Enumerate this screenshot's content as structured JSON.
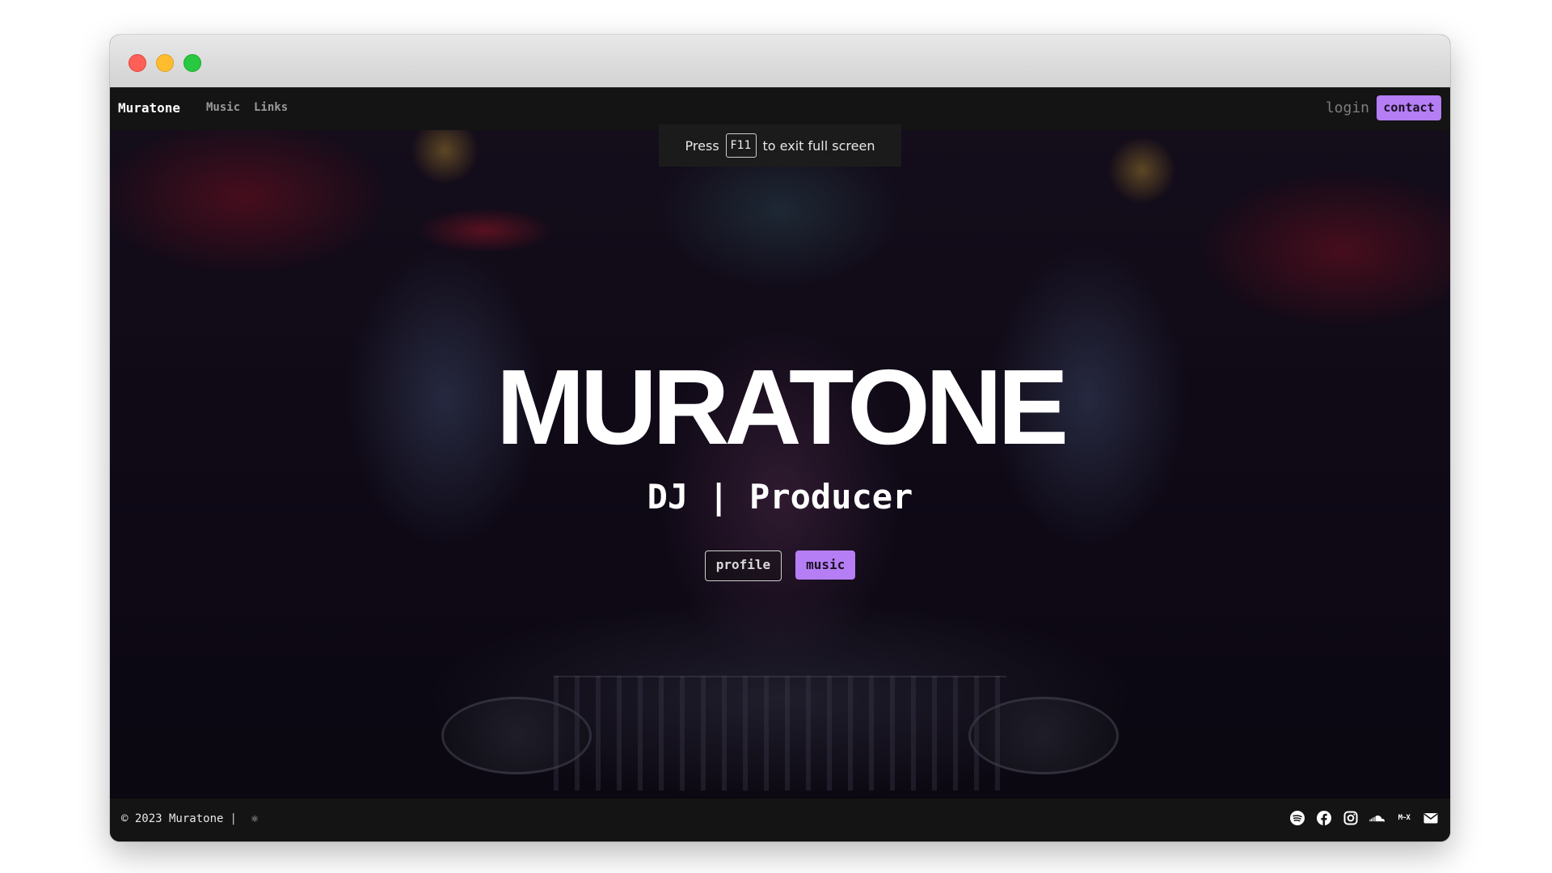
{
  "navbar": {
    "brand": "Muratone",
    "links": [
      "Music",
      "Links"
    ],
    "login": "login",
    "contact": "contact"
  },
  "toast": {
    "before": "Press",
    "key": "F11",
    "after": "to exit full screen"
  },
  "hero": {
    "title": "MURATONE",
    "subtitle": "DJ | Producer",
    "buttons": {
      "profile": "profile",
      "music": "music"
    }
  },
  "footer": {
    "copyright": "© 2023 Muratone",
    "divider": "|",
    "social_icons": [
      "spotify-icon",
      "facebook-icon",
      "instagram-icon",
      "soundcloud-icon",
      "mixcloud-icon",
      "mail-icon"
    ],
    "mixcloud_label": "M~X"
  },
  "colors": {
    "accent": "#b57ef5",
    "navbar_bg": "#141414",
    "title_text": "#ffffff"
  }
}
